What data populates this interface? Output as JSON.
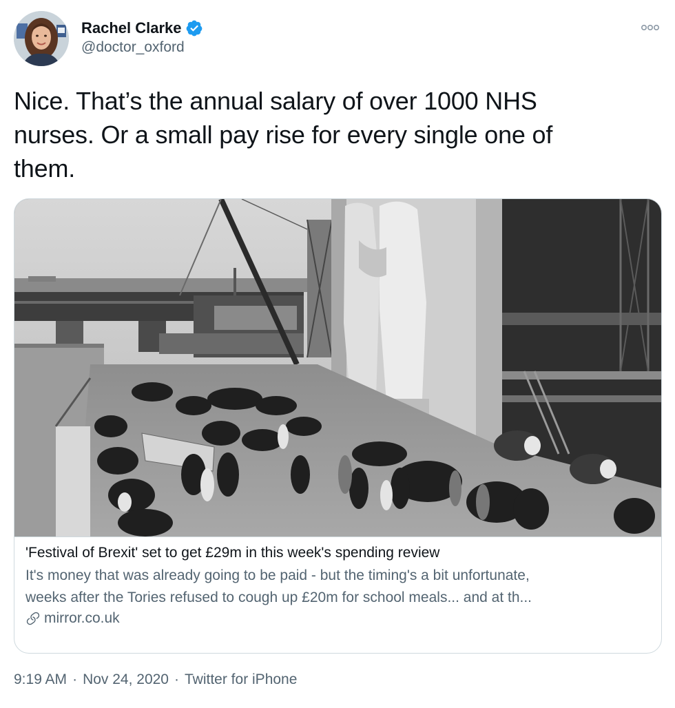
{
  "tweet": {
    "author": {
      "display_name": "Rachel Clarke",
      "handle": "@doctor_oxford",
      "verified": true,
      "verified_icon": "verified-badge-icon",
      "verified_color": "#1d9bf0"
    },
    "text_lines": [
      "Nice. That’s the annual salary of over 1000 NHS",
      "nurses. Or a small pay rise for every single one of",
      "them."
    ],
    "more_icon": "more-options-icon",
    "card": {
      "title": "'Festival of Brexit' set to get £29m in this week's spending review",
      "description_lines": [
        "It's money that was already going to be paid - but the timing's a bit unfortunate,",
        "weeks after the Tories refused to cough up £20m for school meals... and at th..."
      ],
      "domain": "mirror.co.uk",
      "domain_icon": "link-icon"
    },
    "meta": {
      "time": "9:19 AM",
      "date": "Nov 24, 2020",
      "separator": "·",
      "source": "Twitter for iPhone"
    }
  },
  "colors": {
    "text_primary": "#0f1419",
    "text_secondary": "#536471",
    "border": "#cfd9de",
    "accent": "#1d9bf0"
  }
}
